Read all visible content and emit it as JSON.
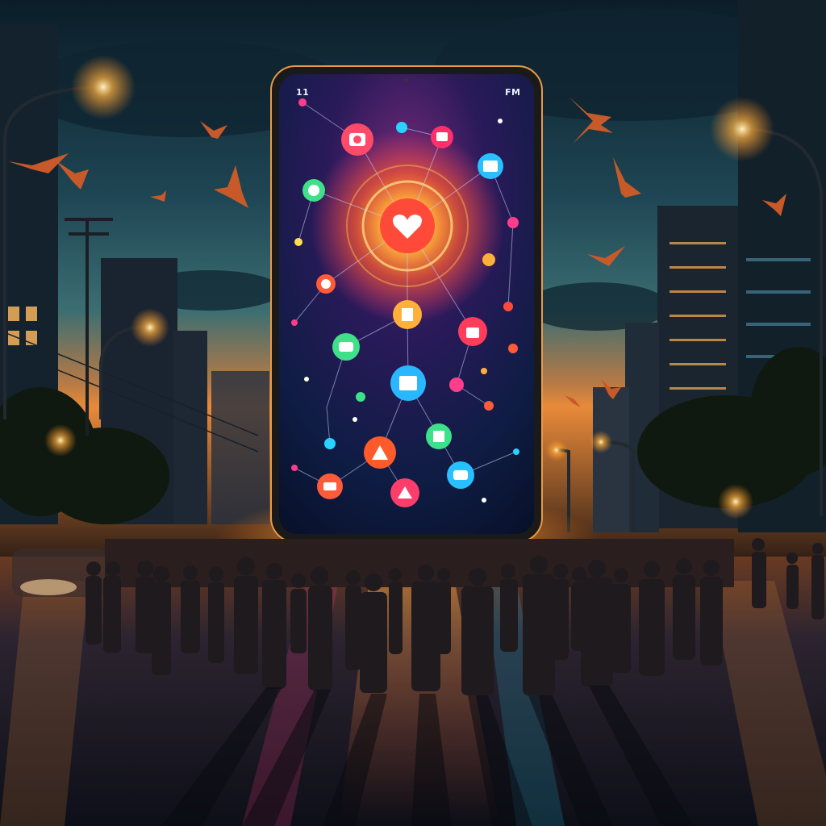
{
  "phone": {
    "status_left": "11",
    "status_right": "FM"
  },
  "colors": {
    "sky_top": "#0e2330",
    "sky_mid": "#2f5d66",
    "horizon": "#e88a3a",
    "street_glow": "#ff9a3c",
    "accent_pink": "#ff3d8b",
    "accent_cyan": "#29d3ff",
    "accent_green": "#3ee08a"
  },
  "icons": [
    "camera-icon",
    "chat-icon",
    "photo-icon",
    "heart-icon",
    "gift-icon",
    "lock-icon",
    "clock-icon",
    "chat-bubble-icon",
    "music-icon",
    "message-icon",
    "home-icon",
    "mail-icon",
    "bell-icon"
  ]
}
